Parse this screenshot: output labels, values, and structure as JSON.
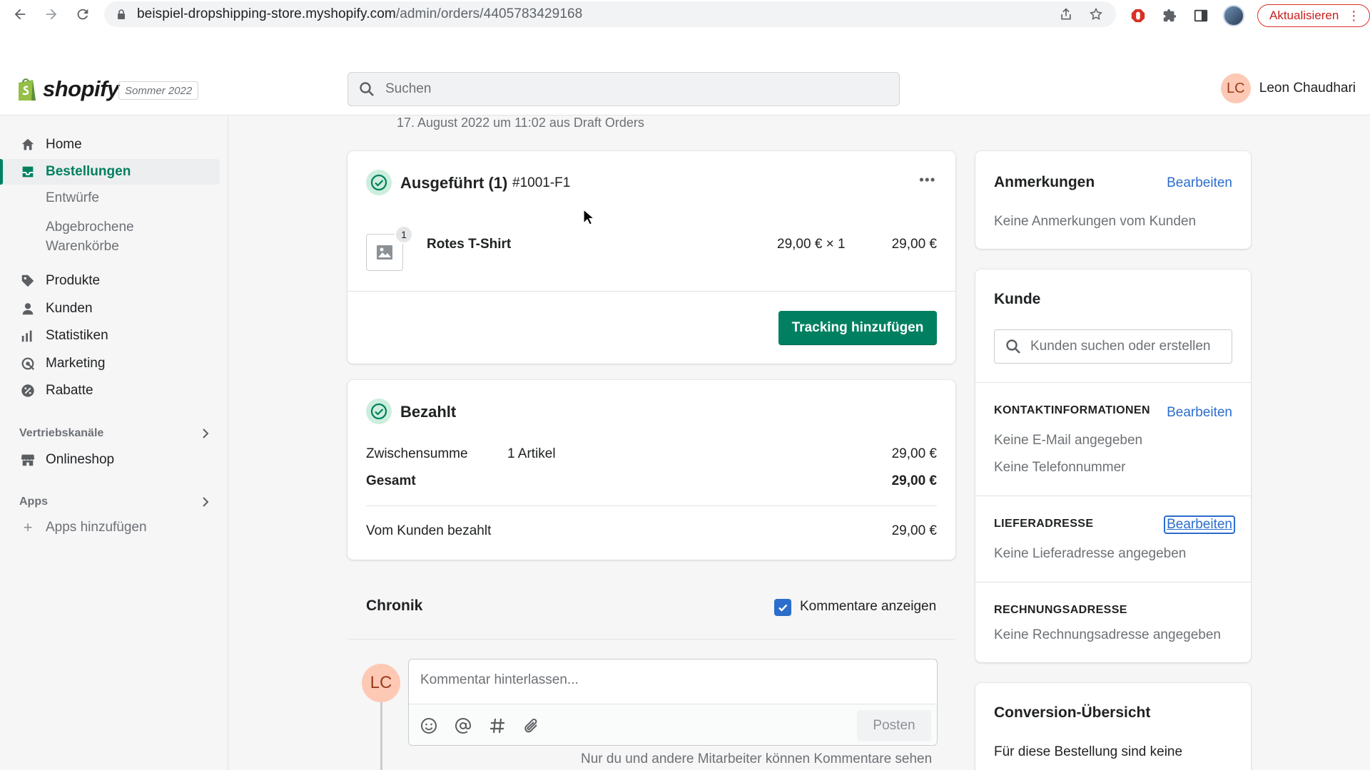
{
  "browser": {
    "url_host": "beispiel-dropshipping-store.myshopify.com",
    "url_path": "/admin/orders/4405783429168",
    "update_label": "Aktualisieren"
  },
  "topbar": {
    "logo_text": "shopify",
    "edition": "Sommer 2022",
    "search_placeholder": "Suchen",
    "user_initials": "LC",
    "user_name": "Leon Chaudhari"
  },
  "sidebar": {
    "items": [
      {
        "label": "Home",
        "icon": "home-icon"
      },
      {
        "label": "Bestellungen",
        "icon": "orders-icon",
        "active": true
      },
      {
        "label": "Produkte",
        "icon": "tag-icon"
      },
      {
        "label": "Kunden",
        "icon": "person-icon"
      },
      {
        "label": "Statistiken",
        "icon": "bar-chart-icon"
      },
      {
        "label": "Marketing",
        "icon": "marketing-icon"
      },
      {
        "label": "Rabatte",
        "icon": "discount-icon"
      },
      {
        "label": "Onlineshop",
        "icon": "store-icon"
      }
    ],
    "sub_items": [
      "Entwürfe",
      "Abgebrochene",
      "Warenkörbe"
    ],
    "sales_channels_title": "Vertriebskanäle",
    "apps_title": "Apps",
    "add_apps_label": "Apps hinzufügen"
  },
  "order": {
    "date_line": "17. August 2022 um 11:02 aus Draft Orders",
    "fulfilled": {
      "title": "Ausgeführt (1)",
      "id": "#1001-F1",
      "item_name": "Rotes T-Shirt",
      "item_qty": "1",
      "item_unit": "29,00 € × 1",
      "item_total": "29,00 €",
      "tracking_button": "Tracking hinzufügen"
    },
    "paid": {
      "title": "Bezahlt",
      "subtotal_label": "Zwischensumme",
      "subtotal_count": "1 Artikel",
      "subtotal_value": "29,00 €",
      "total_label": "Gesamt",
      "total_value": "29,00 €",
      "paid_by_customer_label": "Vom Kunden bezahlt",
      "paid_by_customer_value": "29,00 €"
    },
    "timeline": {
      "title": "Chronik",
      "show_comments_label": "Kommentare anzeigen",
      "show_comments_checked": true,
      "avatar_initials": "LC",
      "comment_placeholder": "Kommentar hinterlassen...",
      "post_button": "Posten",
      "hint": "Nur du und andere Mitarbeiter können Kommentare sehen"
    }
  },
  "notes": {
    "title": "Anmerkungen",
    "edit_label": "Bearbeiten",
    "text": "Keine Anmerkungen vom Kunden"
  },
  "customer": {
    "title": "Kunde",
    "search_placeholder": "Kunden suchen oder erstellen",
    "contact_title": "KONTAKTINFORMATIONEN",
    "contact_edit": "Bearbeiten",
    "no_email": "Keine E-Mail angegeben",
    "no_phone": "Keine Telefonnummer",
    "shipping_title": "LIEFERADRESSE",
    "shipping_edit": "Bearbeiten",
    "no_shipping": "Keine Lieferadresse angegeben",
    "billing_title": "RECHNUNGSADRESSE",
    "no_billing": "Keine Rechnungsadresse angegeben"
  },
  "conversion": {
    "title": "Conversion-Übersicht",
    "text": "Für diese Bestellung sind keine"
  },
  "colors": {
    "primary": "#008060",
    "link": "#2c6ecb",
    "success_bg": "#cdeedd",
    "avatar_bg": "#fdc9b4"
  }
}
